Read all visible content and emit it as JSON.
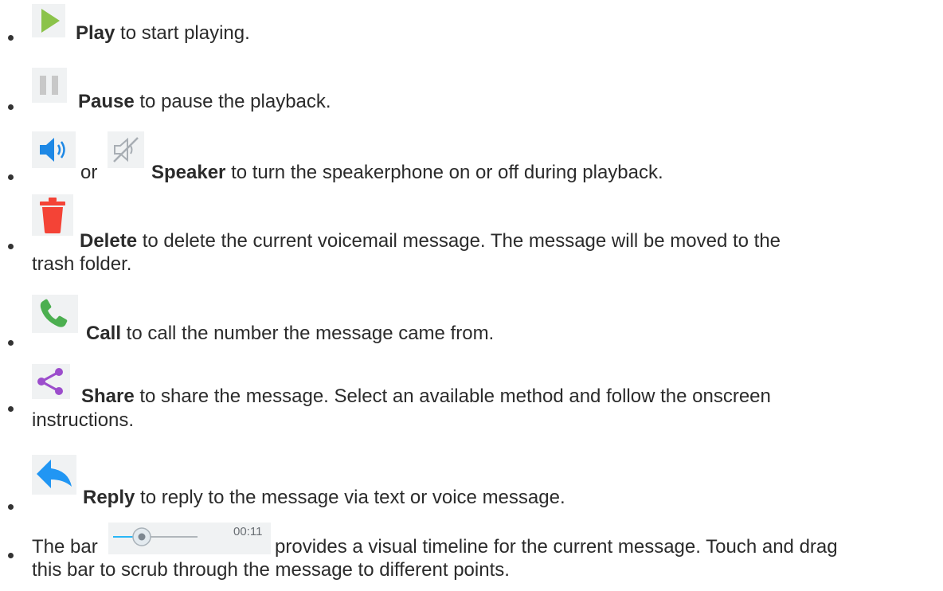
{
  "items": [
    {
      "icon": "play-icon",
      "term": "Play",
      "desc": " to start playing."
    },
    {
      "icon": "pause-icon",
      "term": "Pause",
      "desc": " to pause the playback."
    },
    {
      "icon_a": "speaker-on-icon",
      "icon_b": "speaker-off-icon",
      "or": "or",
      "term": "Speaker",
      "desc": " to turn the speakerphone on or off during playback."
    },
    {
      "icon": "trash-icon",
      "term": "Delete",
      "desc_line1": " to delete the current voicemail message. The message will be moved to the",
      "desc_line2": "trash folder."
    },
    {
      "icon": "phone-icon",
      "term": "Call",
      "desc": " to call the number the message came from."
    },
    {
      "icon": "share-icon",
      "term": "Share",
      "desc_line1": " to share the message. Select an available method and follow the onscreen",
      "desc_line2": "instructions."
    },
    {
      "icon": "reply-icon",
      "term": "Reply",
      "desc": " to reply to the message via text or voice message."
    },
    {
      "lead": "The bar",
      "timeline_icon": "timeline-bar-icon",
      "timeline_time": "00:11",
      "desc_line1": " provides a visual timeline for the current message. Touch and drag",
      "desc_line2": "this bar to scrub through the message to different points."
    }
  ],
  "colors": {
    "play": "#8bc34a",
    "pause": "#c8c8c8",
    "speaker": "#1e88e5",
    "trash": "#f44336",
    "phone": "#4caf50",
    "share": "#9c4dcc",
    "reply": "#2196f3",
    "timeline": "#29b6f6"
  }
}
